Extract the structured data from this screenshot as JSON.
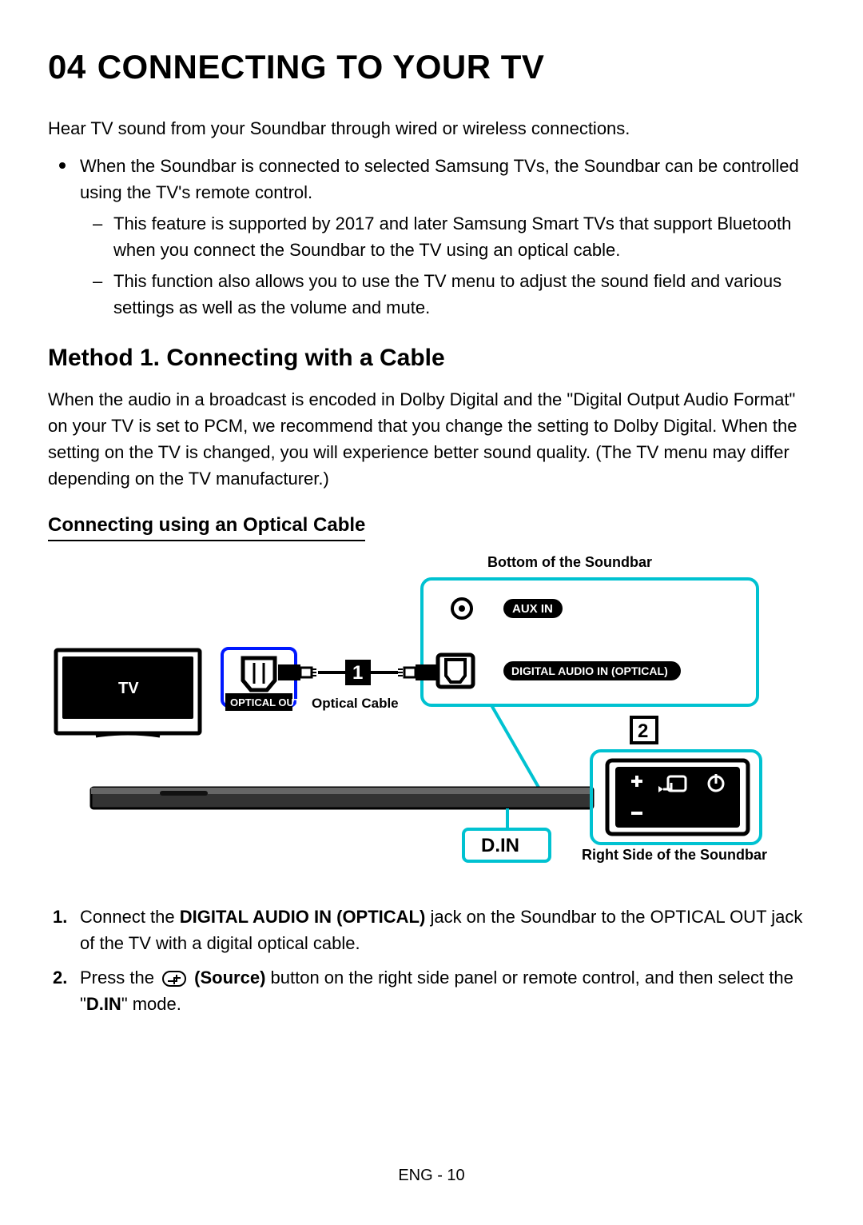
{
  "chapter": {
    "num": "04",
    "title": "CONNECTING TO YOUR TV"
  },
  "intro": "Hear TV sound from your Soundbar through wired or wireless connections.",
  "bullet1": "When the Soundbar is connected to selected Samsung TVs, the Soundbar can be controlled using the TV's remote control.",
  "dash1": "This feature is supported by 2017 and later Samsung Smart TVs that support Bluetooth when you connect the Soundbar to the TV using an optical cable.",
  "dash2": "This function also allows you to use the TV menu to adjust the sound field and various settings as well as the volume and mute.",
  "method_title": "Method 1. Connecting with a Cable",
  "method_para": "When the audio in a broadcast is encoded in Dolby Digital and the \"Digital Output Audio Format\" on your TV is set to PCM, we recommend that you change the setting to Dolby Digital. When the setting on the TV is changed, you will experience better sound quality. (The TV menu may differ depending on the TV manufacturer.)",
  "sub_title": "Connecting using an Optical Cable",
  "diagram": {
    "top_label": "Bottom of the Soundbar",
    "tv_label": "TV",
    "optical_out": "OPTICAL OUT",
    "cable_label": "Optical Cable",
    "aux_in": "AUX IN",
    "optical_in": "DIGITAL AUDIO IN (OPTICAL)",
    "callout1": "1",
    "callout2": "2",
    "din": "D.IN",
    "right_label": "Right Side of the Soundbar"
  },
  "step1": {
    "pre": "Connect the ",
    "bold1": "DIGITAL AUDIO IN (OPTICAL)",
    "mid": " jack on the Soundbar to the OPTICAL OUT jack of the TV with a digital optical cable."
  },
  "step2": {
    "pre": "Press the ",
    "bold1": " (Source)",
    "mid": " button on the right side panel or remote control, and then select the \"",
    "bold2": "D.IN",
    "post": "\" mode."
  },
  "footer": "ENG - 10"
}
